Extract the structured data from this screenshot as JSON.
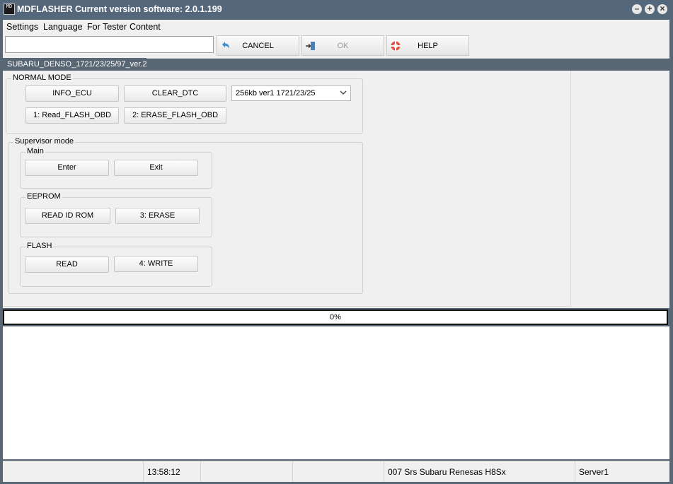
{
  "window": {
    "title": "MDFLASHER  Current version software: 2.0.1.199",
    "icon_text": "MD"
  },
  "menu": [
    "Settings",
    "Language",
    "For Tester",
    "Content"
  ],
  "toolbar": {
    "input_value": "",
    "cancel_label": "CANCEL",
    "ok_label": "OK",
    "help_label": "HELP"
  },
  "tab": {
    "label": "SUBARU_DENSO_1721/23/25/97_ver.2"
  },
  "normal_mode": {
    "label": "NORMAL MODE",
    "info_ecu": "INFO_ECU",
    "clear_dtc": "CLEAR_DTC",
    "read_flash_obd": "1: Read_FLASH_OBD",
    "erase_flash_obd": "2: ERASE_FLASH_OBD",
    "select_value": "256kb ver1 1721/23/25"
  },
  "supervisor": {
    "label": "Supervisor mode",
    "main": {
      "label": "Main",
      "enter": "Enter",
      "exit": "Exit"
    },
    "eeprom": {
      "label": "EEPROM",
      "read_id_rom": "READ ID ROM",
      "erase": "3: ERASE"
    },
    "flash": {
      "label": "FLASH",
      "read": "READ",
      "write": "4: WRITE"
    }
  },
  "progress": {
    "value": 0,
    "text": "0%"
  },
  "status": {
    "time": "13:58:12",
    "device": "007 Srs Subaru Renesas H8Sx",
    "server": "Server1"
  },
  "colors": {
    "title_bar": "#55677a",
    "tab_active": "#596775",
    "help_icon": "#e05040",
    "cancel_icon": "#3b8fd6"
  }
}
